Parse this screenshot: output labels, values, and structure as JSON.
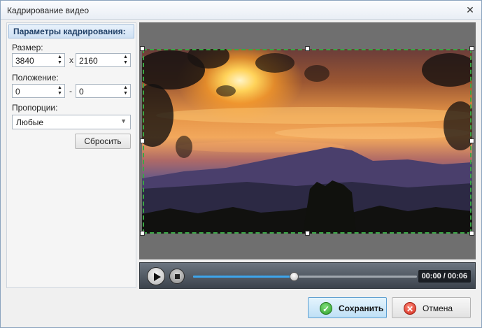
{
  "window": {
    "title": "Кадрирование видео",
    "close_glyph": "✕"
  },
  "panel": {
    "header": "Параметры кадрирования:",
    "size_label": "Размер:",
    "width": "3840",
    "size_sep": "x",
    "height": "2160",
    "position_label": "Положение:",
    "pos_x": "0",
    "pos_sep": "-",
    "pos_y": "0",
    "ratio_label": "Пропорции:",
    "ratio_value": "Любые",
    "reset_label": "Сбросить"
  },
  "player": {
    "time": "00:00 / 00:06",
    "progress": 0.45
  },
  "footer": {
    "save_label": "Сохранить",
    "cancel_label": "Отмена"
  },
  "icons": {
    "close": "close-icon",
    "play": "play-icon",
    "stop": "stop-icon",
    "save": "check-icon",
    "cancel": "cross-icon",
    "spin_up": "chevron-up-icon",
    "spin_down": "chevron-down-icon",
    "dropdown": "chevron-down-icon"
  },
  "colors": {
    "crop_border": "#3aa645",
    "accent": "#3da5ec",
    "save_icon": "#2f9e2a",
    "cancel_icon": "#d32a1c"
  }
}
